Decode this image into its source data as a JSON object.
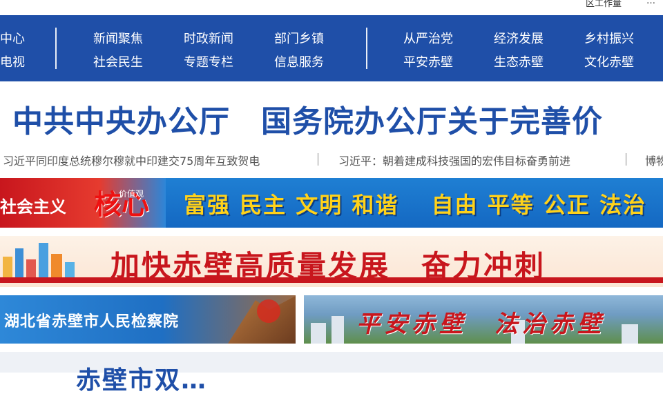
{
  "topbar": {
    "left_text": "区工作量",
    "right_text": "…"
  },
  "nav": {
    "col0": [
      "中心",
      "电视"
    ],
    "col1": [
      "新闻聚焦",
      "社会民生"
    ],
    "col2": [
      "时政新闻",
      "专题专栏"
    ],
    "col3": [
      "部门乡镇",
      "信息服务"
    ],
    "col4": [
      "从严治党",
      "平安赤壁"
    ],
    "col5": [
      "经济发展",
      "生态赤壁"
    ],
    "col6": [
      "乡村振兴",
      "文化赤壁"
    ]
  },
  "headline": "中共中央办公厅　国务院办公厅关于完善价",
  "news": [
    "习近平同印度总统穆尔穆就中印建交75周年互致贺电",
    "习近平：朝着建成科技强国的宏伟目标奋勇前进",
    "博物"
  ],
  "banner_core_values": {
    "left_text": "社会主义",
    "big_char": "核心",
    "small_text": "价值观",
    "values": "富强 民主 文明 和谐　 自由 平等 公正 法治"
  },
  "banner_development": {
    "text": "加快赤壁高质量发展　奋力冲刺"
  },
  "banner_procuratorate": {
    "text": "湖北省赤壁市人民检察院"
  },
  "banner_safe": {
    "text": "平安赤壁　法治赤壁"
  },
  "bottom_headline": "赤壁市双…",
  "colors": {
    "nav_bg": "#1f4fa8",
    "headline": "#1f4fa8",
    "accent_red": "#c8161d",
    "gold": "#ffd21a"
  }
}
